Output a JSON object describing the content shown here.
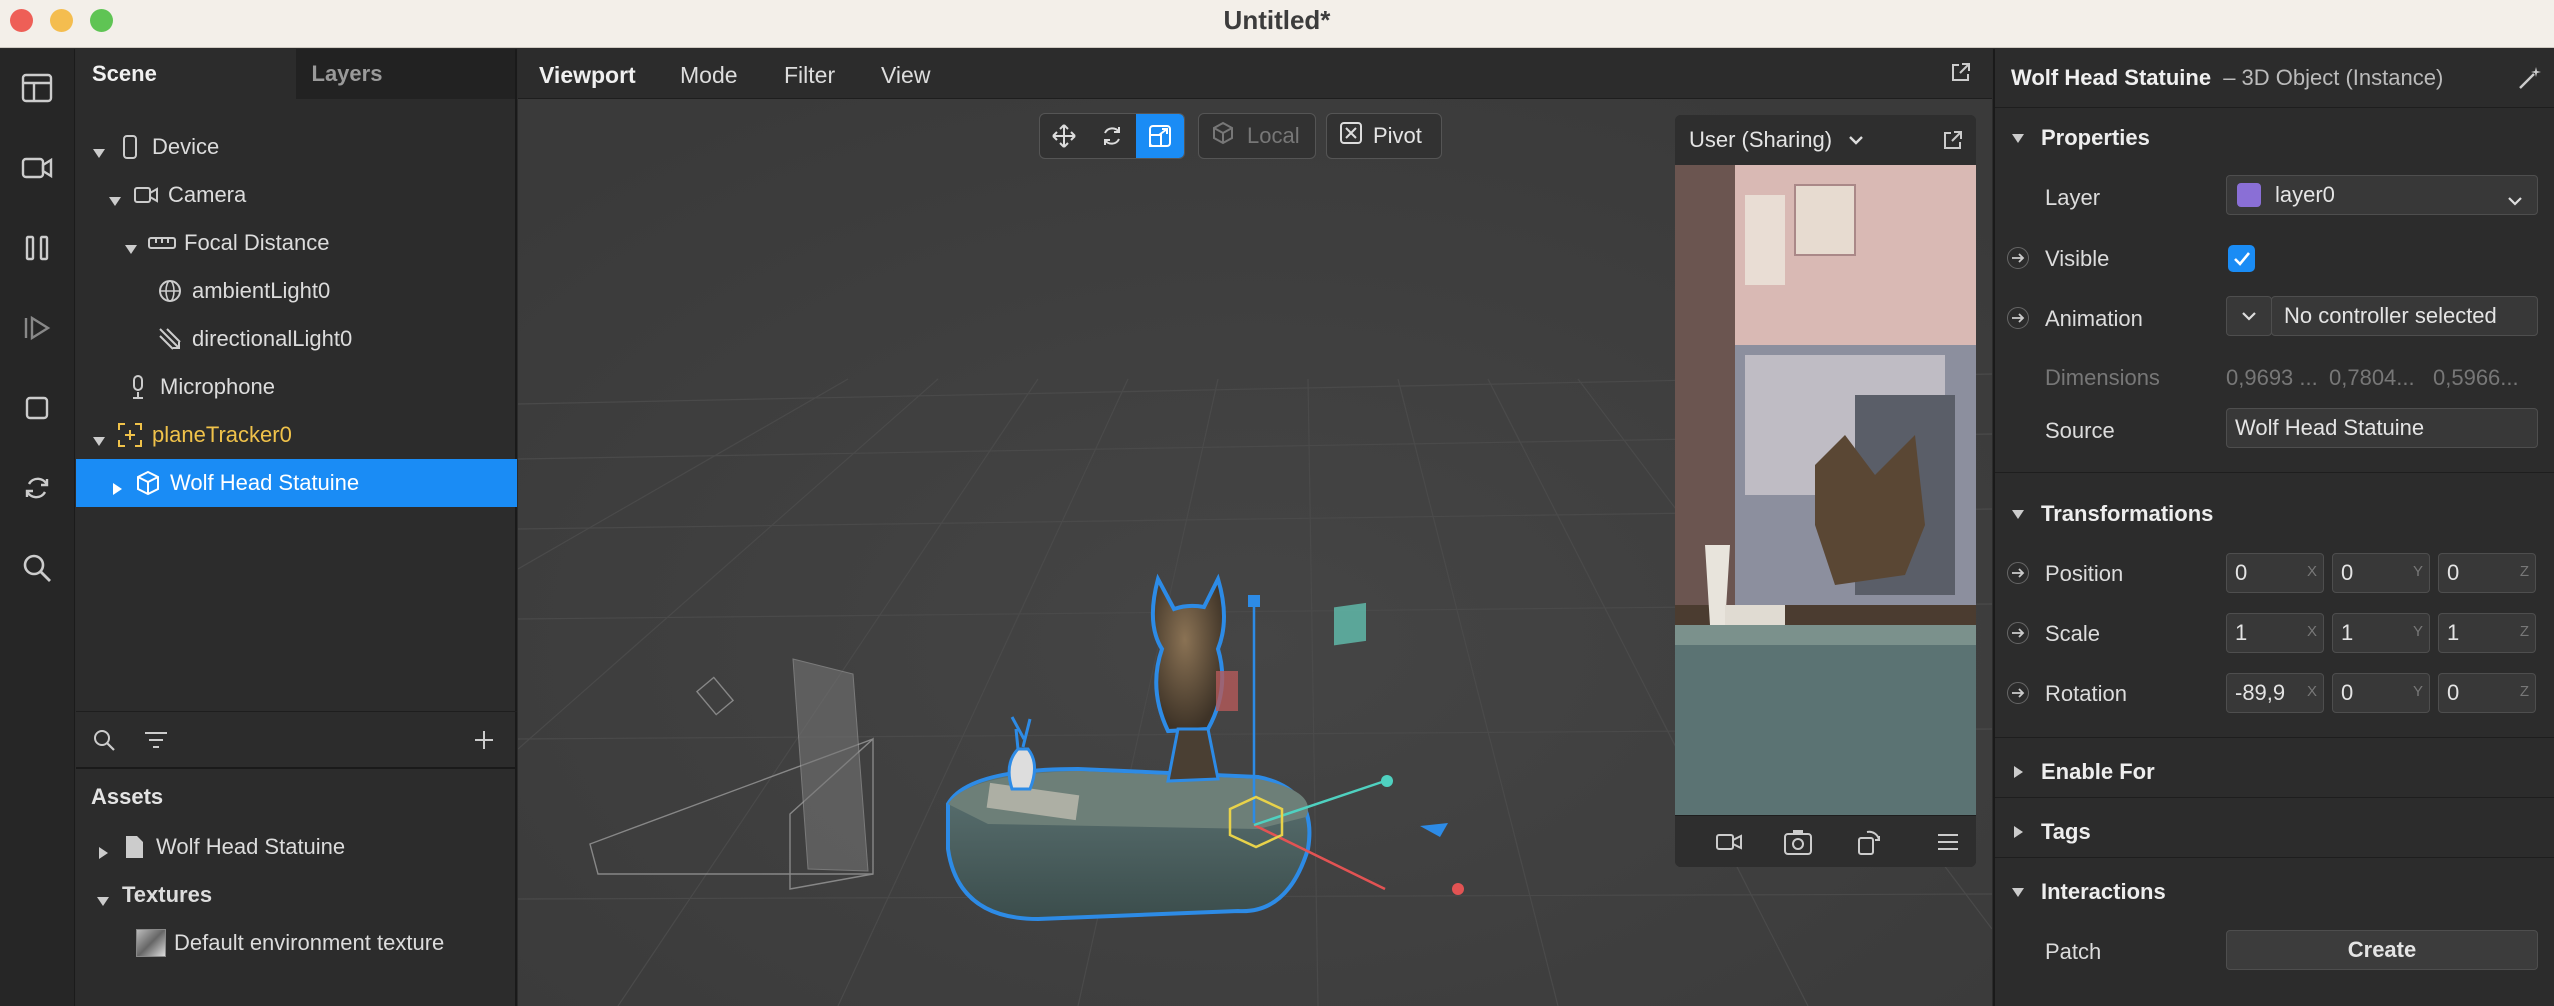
{
  "window": {
    "title": "Untitled*"
  },
  "scene_panel": {
    "tabs": [
      "Scene",
      "Layers"
    ],
    "tree": [
      {
        "label": "Device",
        "icon": "phone-icon"
      },
      {
        "label": "Camera",
        "icon": "camera-icon"
      },
      {
        "label": "Focal Distance",
        "icon": "ruler-icon"
      },
      {
        "label": "ambientLight0",
        "icon": "globe-light-icon"
      },
      {
        "label": "directionalLight0",
        "icon": "directional-light-icon"
      },
      {
        "label": "Microphone",
        "icon": "microphone-icon"
      },
      {
        "label": "planeTracker0",
        "icon": "plane-tracker-icon"
      },
      {
        "label": "Wolf Head Statuine",
        "icon": "cube-icon"
      }
    ],
    "assets_title": "Assets",
    "assets": [
      {
        "label": "Wolf Head Statuine",
        "icon": "file-icon"
      },
      {
        "label": "Textures",
        "icon": ""
      },
      {
        "label": "Default environment texture",
        "icon": "texture-thumb-icon"
      }
    ]
  },
  "viewport": {
    "menus": [
      "Viewport",
      "Mode",
      "Filter",
      "View"
    ],
    "local_label": "Local",
    "pivot_label": "Pivot",
    "preview_device": "User (Sharing)"
  },
  "inspector": {
    "object_name": "Wolf Head Statuine",
    "object_type": "– 3D Object (Instance)",
    "properties_title": "Properties",
    "layer_label": "Layer",
    "layer_value": "layer0",
    "layer_color": "#8a6fd6",
    "visible_label": "Visible",
    "visible_checked": true,
    "animation_label": "Animation",
    "animation_value": "No controller selected",
    "dimensions_label": "Dimensions",
    "dimensions_values": [
      "0,9693 ...",
      "0,7804...",
      "0,5966..."
    ],
    "source_label": "Source",
    "source_value": "Wolf Head Statuine",
    "transformations_title": "Transformations",
    "position_label": "Position",
    "position": [
      "0",
      "0",
      "0"
    ],
    "scale_label": "Scale",
    "scale": [
      "1",
      "1",
      "1"
    ],
    "rotation_label": "Rotation",
    "rotation": [
      "-89,9",
      "0",
      "0"
    ],
    "axes": [
      "X",
      "Y",
      "Z"
    ],
    "enable_for_title": "Enable For",
    "tags_title": "Tags",
    "interactions_title": "Interactions",
    "patch_label": "Patch",
    "create_label": "Create"
  }
}
